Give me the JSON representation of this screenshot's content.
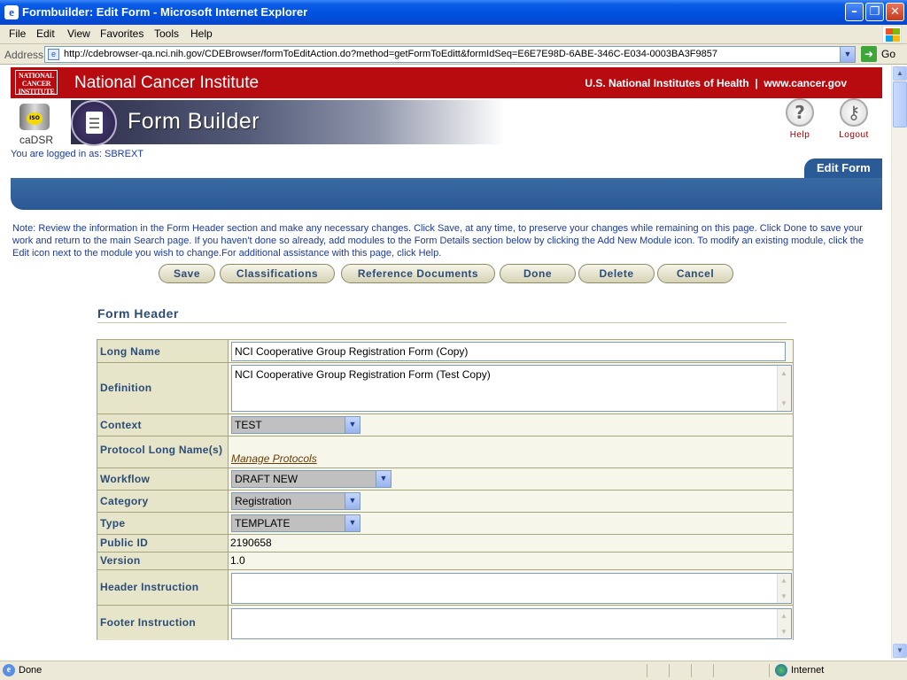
{
  "window": {
    "title": "Formbuilder: Edit Form - Microsoft Internet Explorer",
    "minimize": "–",
    "restore": "❐",
    "close": "✕"
  },
  "menu": [
    "File",
    "Edit",
    "View",
    "Favorites",
    "Tools",
    "Help"
  ],
  "address": {
    "label": "Address",
    "url": "http://cdebrowser-qa.nci.nih.gov/CDEBrowser/formToEditAction.do?method=getFormToEditt&formIdSeq=E6E7E98D-6ABE-346C-E034-0003BA3F9857",
    "go": "Go"
  },
  "banner": {
    "logo_lines": [
      "NATIONAL",
      "CANCER",
      "INSTITUTE"
    ],
    "name": "National Cancer Institute",
    "right": "U.S. National Institutes of Health  |  www.cancer.gov"
  },
  "header": {
    "cadsr": "caDSR",
    "iso": "ISO",
    "app_title": "Form Builder",
    "help": "Help",
    "logout": "Logout",
    "logged_in": "You are logged in as: SBREXT",
    "tab": "Edit Form"
  },
  "note": "Note: Review the information in the Form Header section and make any necessary changes. Click Save, at any time, to preserve your changes while remaining on this page. Click Done to save your work and return to the main Search page. If you haven't done so already, add modules to the Form Details section below by clicking the Add New Module icon. To modify an existing module, click the Edit icon next to the module you wish to change.For additional assistance with this page, click Help.",
  "actions": {
    "save": "Save",
    "classifications": "Classifications",
    "reference_documents": "Reference Documents",
    "done": "Done",
    "delete": "Delete",
    "cancel": "Cancel"
  },
  "form_header": {
    "title": "Form Header",
    "long_name": {
      "label": "Long Name",
      "value": "NCI Cooperative Group Registration Form (Copy)"
    },
    "definition": {
      "label": "Definition",
      "value": "NCI Cooperative Group Registration Form (Test Copy)"
    },
    "context": {
      "label": "Context",
      "value": "TEST"
    },
    "protocol": {
      "label": "Protocol Long Name(s)",
      "link": "Manage Protocols"
    },
    "workflow": {
      "label": "Workflow",
      "value": "DRAFT NEW"
    },
    "category": {
      "label": "Category",
      "value": "Registration"
    },
    "type": {
      "label": "Type",
      "value": "TEMPLATE"
    },
    "public_id": {
      "label": "Public ID",
      "value": "2190658"
    },
    "version": {
      "label": "Version",
      "value": "1.0"
    },
    "header_instruction": {
      "label": "Header Instruction",
      "value": ""
    },
    "footer_instruction": {
      "label": "Footer Instruction",
      "value": ""
    }
  },
  "status": {
    "left": "Done",
    "zone": "Internet"
  },
  "colors": {
    "banner_red": "#b70b10",
    "band_blue": "#2b5b96",
    "label_blue": "#2b4c77",
    "table_border": "#a6a67e"
  }
}
